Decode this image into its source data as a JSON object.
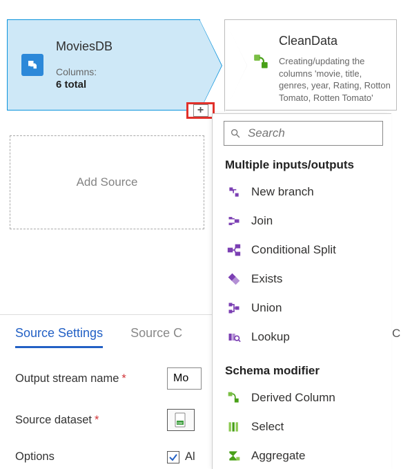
{
  "source_node": {
    "title": "MoviesDB",
    "columns_label": "Columns:",
    "columns_value": "6 total"
  },
  "derived_node": {
    "title": "CleanData",
    "description": "Creating/updating the columns 'movie, title, genres, year, Rating, Rotton Tomato, Rotten Tomato'"
  },
  "add_source_label": "Add Source",
  "plus_symbol": "+",
  "tabs": {
    "source_settings": "Source Settings",
    "source_options_cut": "Source C"
  },
  "form": {
    "output_stream_label": "Output stream name",
    "output_stream_value_cut": "Mo",
    "source_dataset_label": "Source dataset",
    "options_label": "Options",
    "options_checkbox_label_cut": "Al"
  },
  "dropdown": {
    "search_placeholder": "Search",
    "group1": "Multiple inputs/outputs",
    "items1": [
      "New branch",
      "Join",
      "Conditional Split",
      "Exists",
      "Union",
      "Lookup"
    ],
    "group2": "Schema modifier",
    "items2": [
      "Derived Column",
      "Select",
      "Aggregate"
    ]
  },
  "right_pane_cut": "C"
}
